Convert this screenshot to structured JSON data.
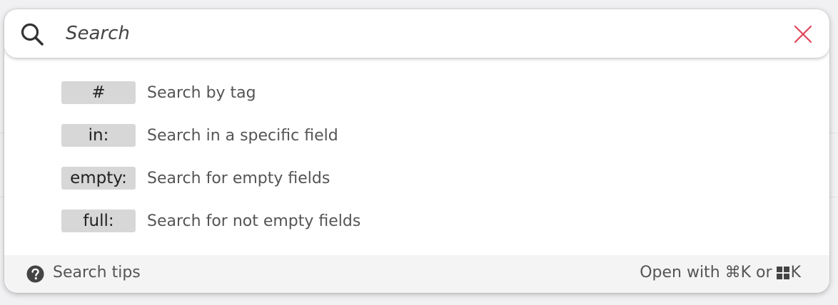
{
  "search": {
    "placeholder": "Search",
    "value": ""
  },
  "hints": [
    {
      "token": "#",
      "description": "Search by tag"
    },
    {
      "token": "in:",
      "description": "Search in a specific field"
    },
    {
      "token": "empty:",
      "description": "Search for empty fields"
    },
    {
      "token": "full:",
      "description": "Search for not empty fields"
    }
  ],
  "footer": {
    "tips_label": "Search tips",
    "shortcut_prefix": "Open with ⌘K or",
    "shortcut_suffix": "K"
  },
  "icons": {
    "search": "search-icon",
    "clear": "close-icon",
    "help": "question-circle-icon",
    "windows": "windows-icon"
  },
  "colors": {
    "clear_icon": "#e0455a",
    "badge_bg": "#d7d7d7",
    "footer_bg": "#f4f4f4"
  }
}
